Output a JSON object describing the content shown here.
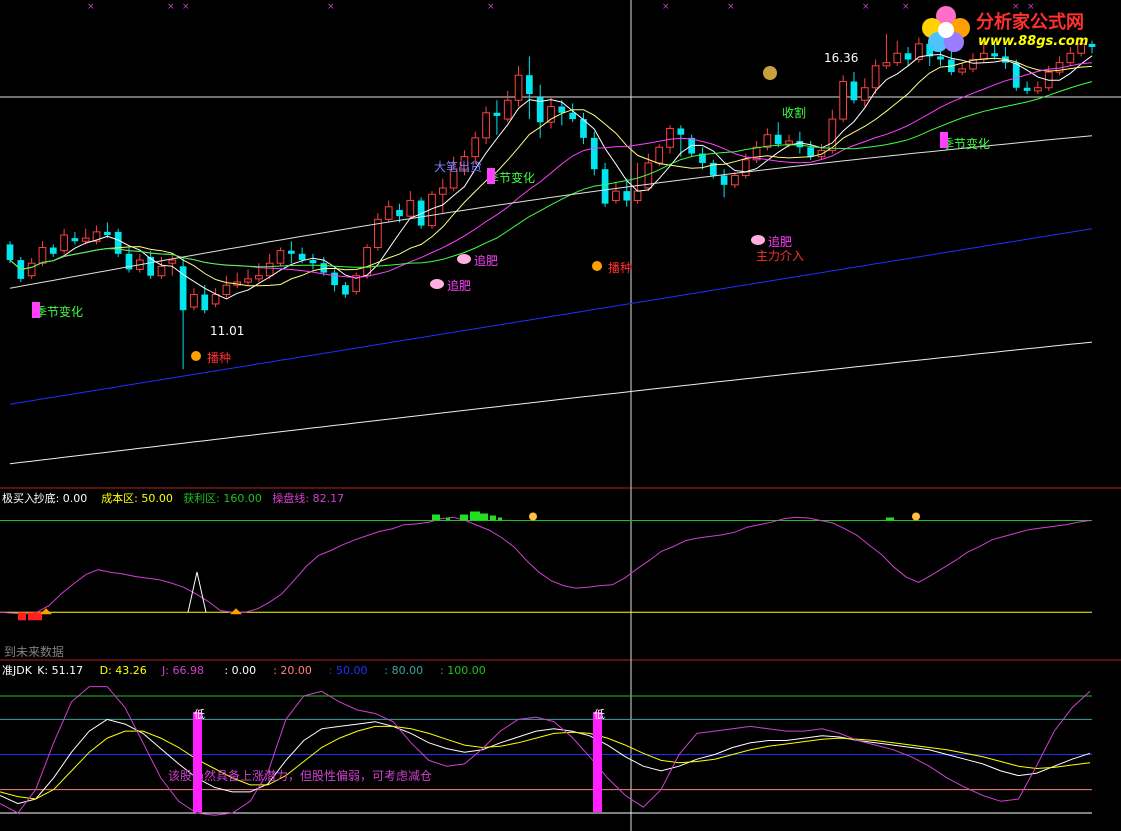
{
  "logo": {
    "title": "分析家公式网",
    "url": "www.88gs.com"
  },
  "colors": {
    "up": "#ff4040",
    "down": "#00e5ee",
    "ma5": "#ffffff",
    "ma10": "#ffff80",
    "ma20": "#ff40ff",
    "ma30": "#40ff40",
    "ma60": "#e0e0e0",
    "ma120": "#2030ff",
    "ma250": "#f0f0f0",
    "purple": "#d040d0",
    "green_lbl": "#20c020",
    "yellow_lbl": "#ffff00",
    "blue_lbl": "#2030ff",
    "teal_lbl": "#40a0a0"
  },
  "icons": {
    "money": "money-bag-icon",
    "seed": "seed-icon",
    "fertilize": "fertilize-icon",
    "runner": "runner-icon",
    "bell": "bell-icon"
  },
  "main_panel": {
    "annotations": [
      {
        "text": "16.36",
        "kind": "high"
      },
      {
        "text": "11.01",
        "kind": "low"
      },
      {
        "text": "收割",
        "kind": "signal"
      },
      {
        "text": "大笔出货",
        "kind": "signal"
      },
      {
        "text": "季节变化",
        "kind": "season"
      },
      {
        "text": "季节变化",
        "kind": "season"
      },
      {
        "text": "季节变化",
        "kind": "season"
      },
      {
        "text": "追肥",
        "kind": "fertilize"
      },
      {
        "text": "追肥",
        "kind": "fertilize"
      },
      {
        "text": "追肥",
        "kind": "fertilize"
      },
      {
        "text": "主力介入",
        "kind": "signal"
      },
      {
        "text": "播种",
        "kind": "seed"
      },
      {
        "text": "播种",
        "kind": "seed"
      }
    ]
  },
  "indicator1": {
    "header": [
      {
        "text": "极买入",
        "color": "#ffffff"
      },
      {
        "text": "抄底: 0.00",
        "color": "#ffffff"
      },
      {
        "text": "成本区: 50.00",
        "color": "#ffff00"
      },
      {
        "text": "获利区: 160.00",
        "color": "#20c020"
      },
      {
        "text": "操盘线: 82.17",
        "color": "#d040d0"
      }
    ],
    "footer_note": "到未来数据"
  },
  "indicator2": {
    "header": [
      {
        "text": "准JDK",
        "color": "#ffffff"
      },
      {
        "text": "K: 51.17",
        "color": "#ffffff"
      },
      {
        "text": "D: 43.26",
        "color": "#ffff00"
      },
      {
        "text": "J: 66.98",
        "color": "#d040d0"
      },
      {
        "text": ": 0.00",
        "color": "#ffffff"
      },
      {
        "text": ": 20.00",
        "color": "#ff8080"
      },
      {
        "text": ": 50.00",
        "color": "#2030ff"
      },
      {
        "text": ": 80.00",
        "color": "#40a0a0"
      },
      {
        "text": ": 100.00",
        "color": "#20c020"
      }
    ],
    "low_label": "低",
    "note": "该股仍然具备上涨潜力，但股性偏弱，可考虑减仓"
  },
  "chart_data": [
    {
      "type": "candlestick",
      "title": "",
      "candles": [
        [
          13.0,
          12.75,
          13.05,
          12.7
        ],
        [
          12.75,
          12.45,
          12.8,
          12.4
        ],
        [
          12.5,
          12.7,
          12.78,
          12.45
        ],
        [
          12.7,
          12.95,
          13.05,
          12.65
        ],
        [
          12.95,
          12.85,
          13.0,
          12.8
        ],
        [
          12.9,
          13.15,
          13.25,
          12.85
        ],
        [
          13.1,
          13.05,
          13.2,
          13.0
        ],
        [
          13.05,
          13.1,
          13.25,
          13.0
        ],
        [
          13.05,
          13.2,
          13.3,
          13.0
        ],
        [
          13.2,
          13.15,
          13.35,
          13.1
        ],
        [
          13.2,
          12.85,
          13.25,
          12.8
        ],
        [
          12.85,
          12.6,
          12.95,
          12.55
        ],
        [
          12.6,
          12.75,
          12.85,
          12.55
        ],
        [
          12.8,
          12.5,
          12.9,
          12.45
        ],
        [
          12.5,
          12.65,
          12.8,
          12.45
        ],
        [
          12.7,
          12.75,
          12.85,
          12.5
        ],
        [
          12.65,
          11.95,
          12.8,
          11.01
        ],
        [
          12.0,
          12.2,
          12.3,
          11.95
        ],
        [
          12.2,
          11.95,
          12.35,
          11.9
        ],
        [
          12.05,
          12.2,
          12.3,
          12.0
        ],
        [
          12.2,
          12.35,
          12.5,
          12.15
        ],
        [
          12.35,
          12.4,
          12.55,
          12.3
        ],
        [
          12.4,
          12.45,
          12.6,
          12.35
        ],
        [
          12.45,
          12.5,
          12.7,
          12.4
        ],
        [
          12.5,
          12.7,
          12.85,
          12.45
        ],
        [
          12.7,
          12.9,
          12.95,
          12.65
        ],
        [
          12.9,
          12.85,
          13.05,
          12.7
        ],
        [
          12.85,
          12.75,
          12.95,
          12.7
        ],
        [
          12.75,
          12.7,
          12.85,
          12.6
        ],
        [
          12.7,
          12.55,
          12.8,
          12.5
        ],
        [
          12.55,
          12.35,
          12.6,
          12.25
        ],
        [
          12.35,
          12.2,
          12.4,
          12.15
        ],
        [
          12.25,
          12.5,
          12.55,
          12.2
        ],
        [
          12.5,
          12.95,
          13.0,
          12.45
        ],
        [
          12.95,
          13.4,
          13.5,
          12.9
        ],
        [
          13.4,
          13.6,
          13.7,
          13.35
        ],
        [
          13.55,
          13.45,
          13.65,
          13.35
        ],
        [
          13.45,
          13.7,
          13.85,
          13.4
        ],
        [
          13.7,
          13.3,
          13.75,
          13.25
        ],
        [
          13.3,
          13.8,
          13.85,
          13.25
        ],
        [
          13.8,
          13.9,
          14.05,
          13.5
        ],
        [
          13.9,
          14.2,
          14.4,
          13.85
        ],
        [
          14.2,
          14.4,
          14.5,
          14.1
        ],
        [
          14.4,
          14.7,
          14.8,
          14.3
        ],
        [
          14.7,
          15.1,
          15.2,
          14.6
        ],
        [
          15.1,
          15.05,
          15.3,
          14.75
        ],
        [
          15.0,
          15.3,
          15.45,
          14.95
        ],
        [
          15.3,
          15.7,
          15.85,
          15.2
        ],
        [
          15.7,
          15.4,
          16.0,
          15.0
        ],
        [
          15.35,
          14.95,
          15.55,
          14.7
        ],
        [
          14.95,
          15.2,
          15.35,
          14.85
        ],
        [
          15.2,
          15.1,
          15.3,
          14.9
        ],
        [
          15.1,
          15.0,
          15.25,
          14.95
        ],
        [
          15.0,
          14.7,
          15.1,
          14.6
        ],
        [
          14.7,
          14.2,
          14.8,
          14.1
        ],
        [
          14.2,
          13.65,
          14.3,
          13.6
        ],
        [
          13.7,
          13.85,
          14.0,
          13.65
        ],
        [
          13.85,
          13.7,
          14.05,
          13.6
        ],
        [
          13.7,
          13.85,
          14.3,
          13.65
        ],
        [
          13.9,
          14.3,
          14.45,
          13.85
        ],
        [
          14.3,
          14.55,
          14.6,
          14.25
        ],
        [
          14.55,
          14.85,
          14.9,
          14.45
        ],
        [
          14.85,
          14.75,
          14.9,
          14.4
        ],
        [
          14.7,
          14.45,
          14.75,
          14.4
        ],
        [
          14.45,
          14.3,
          14.55,
          14.2
        ],
        [
          14.3,
          14.1,
          14.35,
          14.05
        ],
        [
          14.1,
          13.95,
          14.2,
          13.75
        ],
        [
          13.95,
          14.1,
          14.15,
          13.9
        ],
        [
          14.1,
          14.35,
          14.45,
          14.05
        ],
        [
          14.35,
          14.55,
          14.65,
          14.3
        ],
        [
          14.55,
          14.75,
          14.85,
          14.5
        ],
        [
          14.75,
          14.6,
          14.95,
          14.55
        ],
        [
          14.6,
          14.65,
          14.75,
          14.55
        ],
        [
          14.65,
          14.55,
          14.8,
          14.45
        ],
        [
          14.55,
          14.4,
          14.65,
          14.35
        ],
        [
          14.4,
          14.5,
          14.6,
          14.35
        ],
        [
          14.5,
          15.0,
          15.15,
          14.45
        ],
        [
          15.0,
          15.6,
          15.7,
          14.95
        ],
        [
          15.6,
          15.3,
          15.75,
          15.25
        ],
        [
          15.3,
          15.5,
          15.65,
          15.2
        ],
        [
          15.5,
          15.85,
          15.95,
          15.4
        ],
        [
          15.85,
          15.9,
          16.36,
          15.8
        ],
        [
          15.9,
          16.05,
          16.25,
          15.85
        ],
        [
          16.05,
          15.95,
          16.15,
          15.85
        ],
        [
          15.95,
          16.2,
          16.3,
          15.9
        ],
        [
          16.2,
          16.0,
          16.3,
          15.85
        ],
        [
          16.0,
          15.95,
          16.15,
          15.85
        ],
        [
          15.95,
          15.75,
          16.1,
          15.7
        ],
        [
          15.75,
          15.8,
          15.9,
          15.7
        ],
        [
          15.8,
          15.95,
          16.05,
          15.75
        ],
        [
          15.95,
          16.05,
          16.25,
          15.9
        ],
        [
          16.05,
          16.0,
          16.2,
          15.95
        ],
        [
          16.0,
          15.9,
          16.15,
          15.8
        ],
        [
          15.9,
          15.5,
          15.95,
          15.45
        ],
        [
          15.5,
          15.45,
          15.6,
          15.4
        ],
        [
          15.45,
          15.5,
          15.6,
          15.4
        ],
        [
          15.5,
          15.75,
          15.85,
          15.45
        ],
        [
          15.75,
          15.9,
          16.0,
          15.7
        ],
        [
          15.9,
          16.05,
          16.15,
          15.85
        ],
        [
          16.05,
          16.2,
          16.3,
          16.0
        ],
        [
          16.2,
          16.15,
          16.25,
          16.05
        ]
      ],
      "ylim": [
        9.4,
        16.9
      ]
    },
    {
      "type": "line",
      "title": "",
      "series": [
        {
          "values": [
            0,
            0,
            0,
            0,
            0,
            0,
            0,
            0,
            0,
            0,
            0,
            0,
            0,
            0,
            0,
            0,
            0,
            0,
            0,
            0,
            0,
            0,
            0,
            0,
            0,
            0,
            0,
            0,
            0,
            0,
            0,
            0,
            0,
            0,
            0,
            0,
            0,
            0,
            0,
            0,
            0,
            0,
            0,
            0,
            0,
            0,
            0,
            0,
            0,
            0,
            0,
            0,
            0,
            0,
            0,
            0,
            0,
            0,
            0,
            0,
            0,
            0,
            0,
            0,
            0,
            0,
            0,
            0,
            0,
            0,
            0,
            0,
            0,
            0,
            0,
            0,
            0,
            0,
            0,
            0,
            0,
            0,
            0,
            0,
            0,
            0,
            0,
            0,
            0,
            0,
            0,
            0,
            0,
            0,
            0,
            0,
            0,
            0,
            0,
            0,
            0
          ]
        },
        {
          "values": [
            50,
            49,
            48,
            50,
            58,
            72,
            84,
            95,
            101,
            98,
            96,
            93,
            91,
            89,
            85,
            80,
            72,
            63,
            52,
            50,
            50,
            54,
            62,
            72,
            88,
            105,
            118,
            124,
            131,
            137,
            142,
            147,
            150,
            155,
            156,
            158,
            162,
            164,
            160,
            154,
            148,
            139,
            128,
            112,
            98,
            88,
            82,
            79,
            80,
            82,
            83,
            91,
            102,
            112,
            123,
            129,
            136,
            139,
            141,
            143,
            146,
            152,
            155,
            158,
            162,
            164,
            163,
            160,
            157,
            150,
            142,
            130,
            119,
            104,
            92,
            86,
            94,
            103,
            112,
            122,
            129,
            137,
            141,
            145,
            149,
            151,
            153,
            155,
            158,
            160
          ]
        }
      ],
      "ylim": [
        0,
        175
      ]
    },
    {
      "type": "line",
      "title": "",
      "series": [
        {
          "values": [
            15,
            8,
            12,
            30,
            52,
            70,
            80,
            76,
            68,
            55,
            42,
            30,
            22,
            18,
            18,
            25,
            45,
            62,
            72,
            74,
            76,
            78,
            74,
            68,
            60,
            55,
            52,
            54,
            60,
            65,
            70,
            72,
            70,
            66,
            58,
            48,
            40,
            36,
            40,
            46,
            50,
            56,
            60,
            62,
            62,
            64,
            66,
            65,
            62,
            60,
            58,
            56,
            54,
            50,
            46,
            42,
            36,
            32,
            34,
            40,
            46,
            51
          ]
        },
        {
          "values": [
            18,
            14,
            12,
            20,
            36,
            52,
            64,
            70,
            70,
            64,
            56,
            46,
            38,
            30,
            24,
            24,
            32,
            44,
            56,
            64,
            70,
            74,
            74,
            72,
            68,
            63,
            58,
            56,
            57,
            60,
            64,
            68,
            69,
            68,
            64,
            58,
            51,
            45,
            43,
            44,
            46,
            50,
            54,
            57,
            59,
            61,
            63,
            64,
            63,
            62,
            60,
            58,
            56,
            54,
            51,
            48,
            44,
            40,
            38,
            39,
            41,
            43
          ]
        },
        {
          "values": [
            8,
            0,
            20,
            60,
            95,
            108,
            108,
            90,
            60,
            30,
            10,
            0,
            -2,
            0,
            10,
            35,
            80,
            100,
            104,
            95,
            88,
            85,
            78,
            60,
            45,
            40,
            42,
            55,
            70,
            80,
            82,
            78,
            65,
            48,
            30,
            15,
            5,
            20,
            50,
            68,
            70,
            72,
            74,
            72,
            70,
            70,
            72,
            68,
            62,
            58,
            54,
            48,
            40,
            30,
            22,
            15,
            10,
            12,
            40,
            70,
            90,
            104
          ]
        }
      ],
      "ylim": [
        0,
        100
      ]
    }
  ]
}
